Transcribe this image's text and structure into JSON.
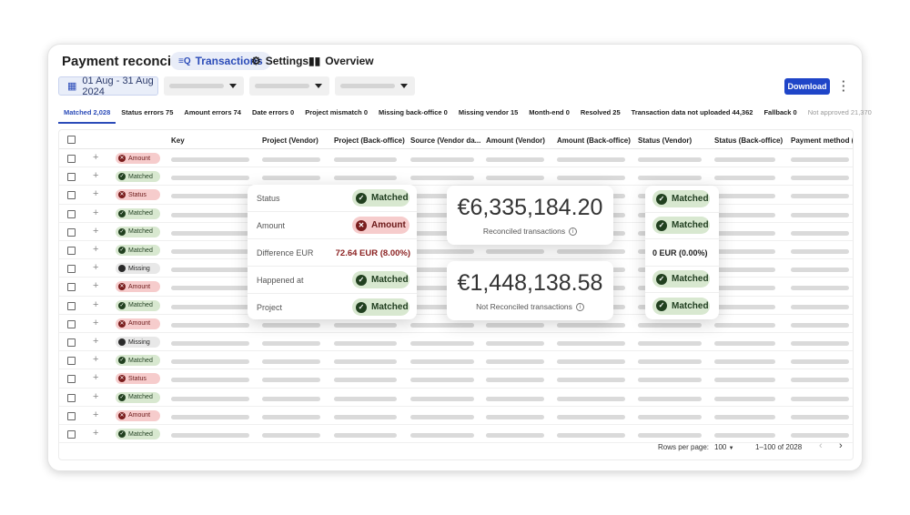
{
  "app": {
    "title": "Payment reconciliation"
  },
  "tabs": [
    {
      "label": "Transactions",
      "icon": "list-search-icon"
    },
    {
      "label": "Settings",
      "icon": "gear-icon"
    },
    {
      "label": "Overview",
      "icon": "dashboard-icon"
    }
  ],
  "toolbar": {
    "date_range": "01 Aug - 31 Aug 2024",
    "download_label": "Download"
  },
  "filter_tabs": [
    "Matched 2,028",
    "Status errors 75",
    "Amount errors 74",
    "Date errors 0",
    "Project mismatch 0",
    "Missing back-office 0",
    "Missing vendor 15",
    "Month-end 0",
    "Resolved 25",
    "Transaction data not uploaded 44,362",
    "Fallback 0",
    "Not approved 21,370"
  ],
  "columns": [
    "Key",
    "Project (Vendor)",
    "Project (Back-office)",
    "Source (Vendor da...",
    "Amount (Vendor)",
    "Amount (Back-office)",
    "Status (Vendor)",
    "Status (Back-office)",
    "Payment method (..."
  ],
  "rows": [
    "Amount",
    "Matched",
    "Status",
    "Matched",
    "Matched",
    "Matched",
    "Missing",
    "Amount",
    "Matched",
    "Amount",
    "Missing",
    "Matched",
    "Status",
    "Matched",
    "Amount",
    "Matched"
  ],
  "row_kinds": [
    "err",
    "ok",
    "err",
    "ok",
    "ok",
    "ok",
    "mis",
    "err",
    "ok",
    "err",
    "mis",
    "ok",
    "err",
    "ok",
    "err",
    "ok"
  ],
  "detail_popup": [
    {
      "label": "Status",
      "value": "Matched",
      "kind": "ok"
    },
    {
      "label": "Amount",
      "value": "Amount",
      "kind": "err"
    },
    {
      "label": "Difference EUR",
      "value": "72.64 EUR (8.00%)",
      "kind": "text"
    },
    {
      "label": "Happened at",
      "value": "Matched",
      "kind": "ok"
    },
    {
      "label": "Project",
      "value": "Matched",
      "kind": "ok"
    }
  ],
  "summary": {
    "reconciled_amount": "€6,335,184.20",
    "reconciled_label": "Reconciled transactions",
    "not_reconciled_amount": "€1,448,138.58",
    "not_reconciled_label": "Not Reconciled transactions"
  },
  "vendor_popup": [
    "Matched",
    "Matched",
    "0 EUR (0.00%)",
    "Matched",
    "Matched"
  ],
  "pagination": {
    "rows_per_page_label": "Rows per page:",
    "rows_per_page": "100",
    "range": "1–100 of 2028"
  },
  "colors": {
    "accent": "#1f45c8",
    "ok_bg": "#d8e8d0",
    "err_bg": "#f6cccc",
    "diff_text": "#8a1f1f"
  }
}
